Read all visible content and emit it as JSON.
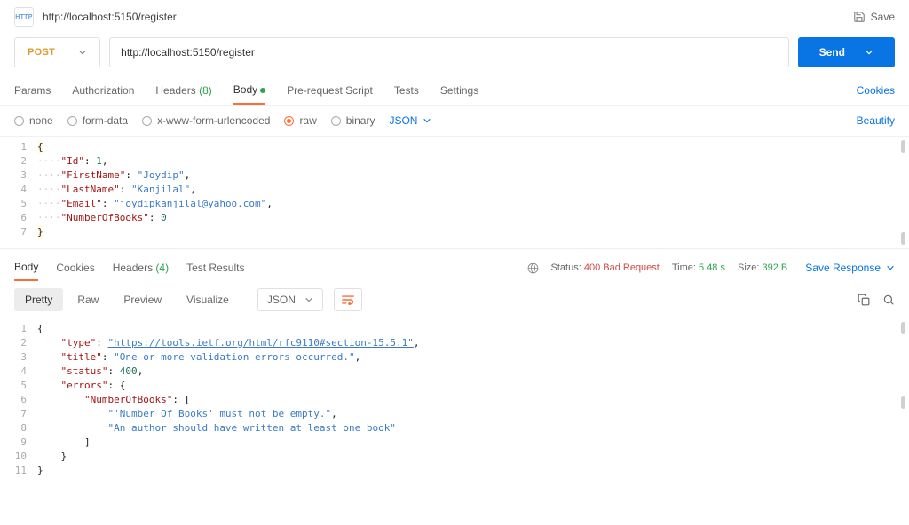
{
  "header": {
    "url_title": "http://localhost:5150/register",
    "save_label": "Save"
  },
  "request": {
    "method": "POST",
    "url": "http://localhost:5150/register",
    "send_label": "Send"
  },
  "reqTabs": {
    "params": "Params",
    "authorization": "Authorization",
    "headers": "Headers",
    "headers_count": "(8)",
    "body": "Body",
    "pre_request": "Pre-request Script",
    "tests": "Tests",
    "settings": "Settings",
    "cookies": "Cookies"
  },
  "bodyType": {
    "none": "none",
    "form_data": "form-data",
    "urlencoded": "x-www-form-urlencoded",
    "raw": "raw",
    "binary": "binary",
    "json": "JSON",
    "beautify": "Beautify"
  },
  "reqBody": {
    "l1": "{",
    "l2_pre": "····",
    "l2_key": "\"Id\"",
    "l2_colon": ": ",
    "l2_val": "1",
    "l2_comma": ",",
    "l3_key": "\"FirstName\"",
    "l3_val": "\"Joydip\"",
    "l4_key": "\"LastName\"",
    "l4_val": "\"Kanjilal\"",
    "l5_key": "\"Email\"",
    "l5_val": "\"joydipkanjilal@yahoo.com\"",
    "l6_key": "\"NumberOfBooks\"",
    "l6_val": "0",
    "l7": "}"
  },
  "respTabs": {
    "body": "Body",
    "cookies": "Cookies",
    "headers": "Headers",
    "headers_count": "(4)",
    "test_results": "Test Results"
  },
  "status": {
    "status_label": "Status:",
    "status_value": "400 Bad Request",
    "time_label": "Time:",
    "time_value": "5.48 s",
    "size_label": "Size:",
    "size_value": "392 B",
    "save_response": "Save Response"
  },
  "view": {
    "pretty": "Pretty",
    "raw": "Raw",
    "preview": "Preview",
    "visualize": "Visualize",
    "json": "JSON"
  },
  "respBody": {
    "l1": "1",
    "l2": "2",
    "l3": "3",
    "l4": "4",
    "l5": "5",
    "l6": "6",
    "l7": "7",
    "l8": "8",
    "l9": "9",
    "l10": "10",
    "l11": "11",
    "brace_open": "{",
    "brace_close": "}",
    "r2_key": "\"type\"",
    "r2_val": "\"https://tools.ietf.org/html/rfc9110#section-15.5.1\"",
    "r3_key": "\"title\"",
    "r3_val": "\"One or more validation errors occurred.\"",
    "r4_key": "\"status\"",
    "r4_val": "400",
    "r5_key": "\"errors\"",
    "r6_key": "\"NumberOfBooks\"",
    "r6_bracket": "[",
    "r7_val": "\"'Number Of Books' must not be empty.\"",
    "r8_val": "\"An author should have written at least one book\"",
    "r9_bracket": "]",
    "comma": ",",
    "colon": ": ",
    "indent1": "    ",
    "indent2": "        ",
    "indent3": "            "
  }
}
